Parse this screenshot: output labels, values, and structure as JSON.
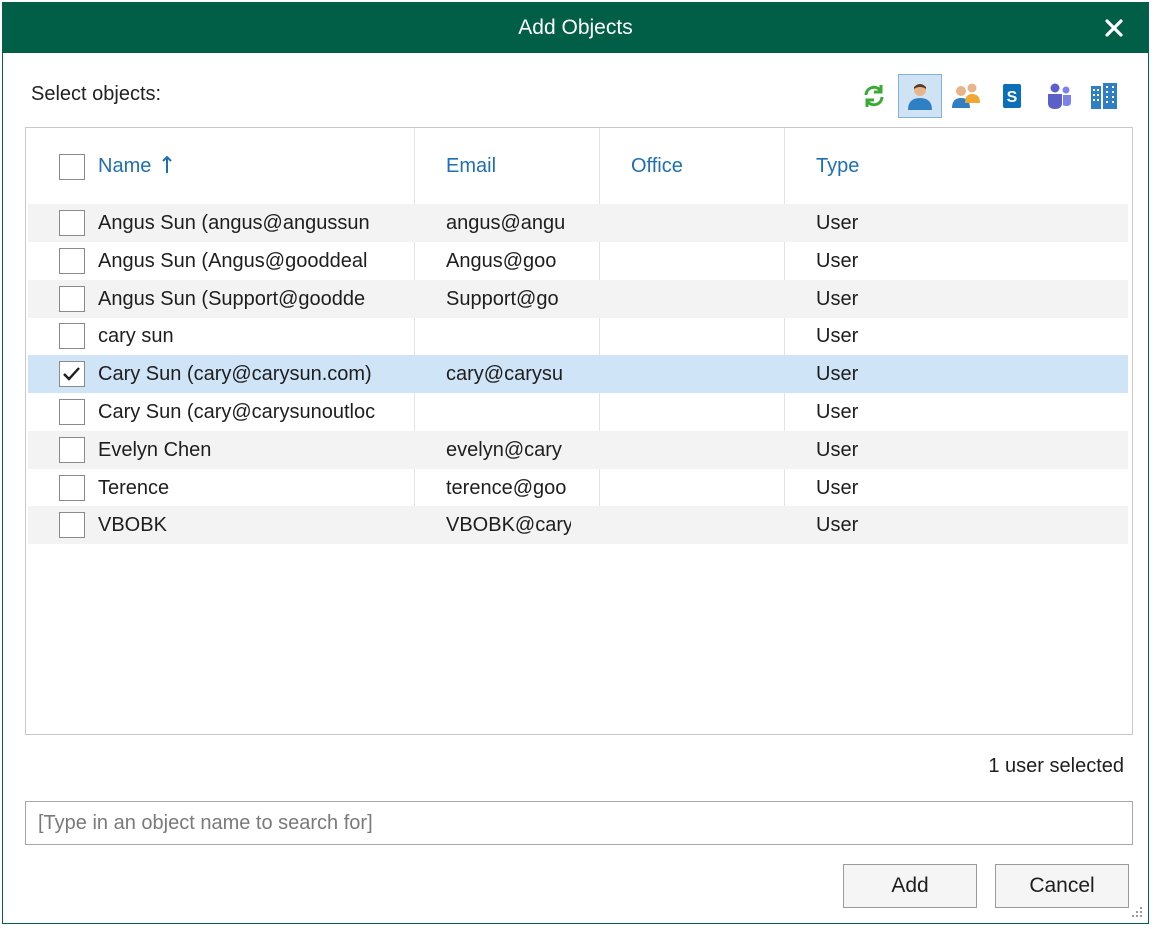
{
  "dialog": {
    "title": "Add Objects",
    "close_icon": "close-icon"
  },
  "select_label": "Select objects:",
  "toolbar": {
    "buttons": [
      {
        "icon": "refresh-icon",
        "active": false
      },
      {
        "icon": "user-icon",
        "active": true
      },
      {
        "icon": "group-icon",
        "active": false
      },
      {
        "icon": "sharepoint-icon",
        "active": false
      },
      {
        "icon": "teams-icon",
        "active": false
      },
      {
        "icon": "organization-icon",
        "active": false
      }
    ]
  },
  "table": {
    "columns": {
      "name": "Name",
      "email": "Email",
      "office": "Office",
      "type": "Type"
    },
    "sort_icon": "sort-ascending-icon",
    "rows": [
      {
        "name": "Angus Sun (angus@angussun",
        "email": "angus@angu",
        "office": "",
        "type": "User",
        "checked": false
      },
      {
        "name": "Angus Sun (Angus@gooddeal",
        "email": "Angus@goo",
        "office": "",
        "type": "User",
        "checked": false
      },
      {
        "name": "Angus Sun (Support@goodde",
        "email": "Support@go",
        "office": "",
        "type": "User",
        "checked": false
      },
      {
        "name": "cary sun",
        "email": "",
        "office": "",
        "type": "User",
        "checked": false
      },
      {
        "name": "Cary Sun (cary@carysun.com)",
        "email": "cary@carysu",
        "office": "",
        "type": "User",
        "checked": true
      },
      {
        "name": "Cary Sun (cary@carysunoutloc",
        "email": "",
        "office": "",
        "type": "User",
        "checked": false
      },
      {
        "name": "Evelyn Chen",
        "email": "evelyn@cary",
        "office": "",
        "type": "User",
        "checked": false
      },
      {
        "name": "Terence",
        "email": "terence@goo",
        "office": "",
        "type": "User",
        "checked": false
      },
      {
        "name": "VBOBK",
        "email": "VBOBK@cary",
        "office": "",
        "type": "User",
        "checked": false
      }
    ]
  },
  "selection_status": "1 user selected",
  "search": {
    "placeholder": "[Type in an object name to search for]",
    "value": ""
  },
  "buttons": {
    "add": "Add",
    "cancel": "Cancel"
  },
  "colors": {
    "titlebar": "#005f46",
    "header_text": "#1f6fb5",
    "selected_row": "#cfe4f7"
  }
}
